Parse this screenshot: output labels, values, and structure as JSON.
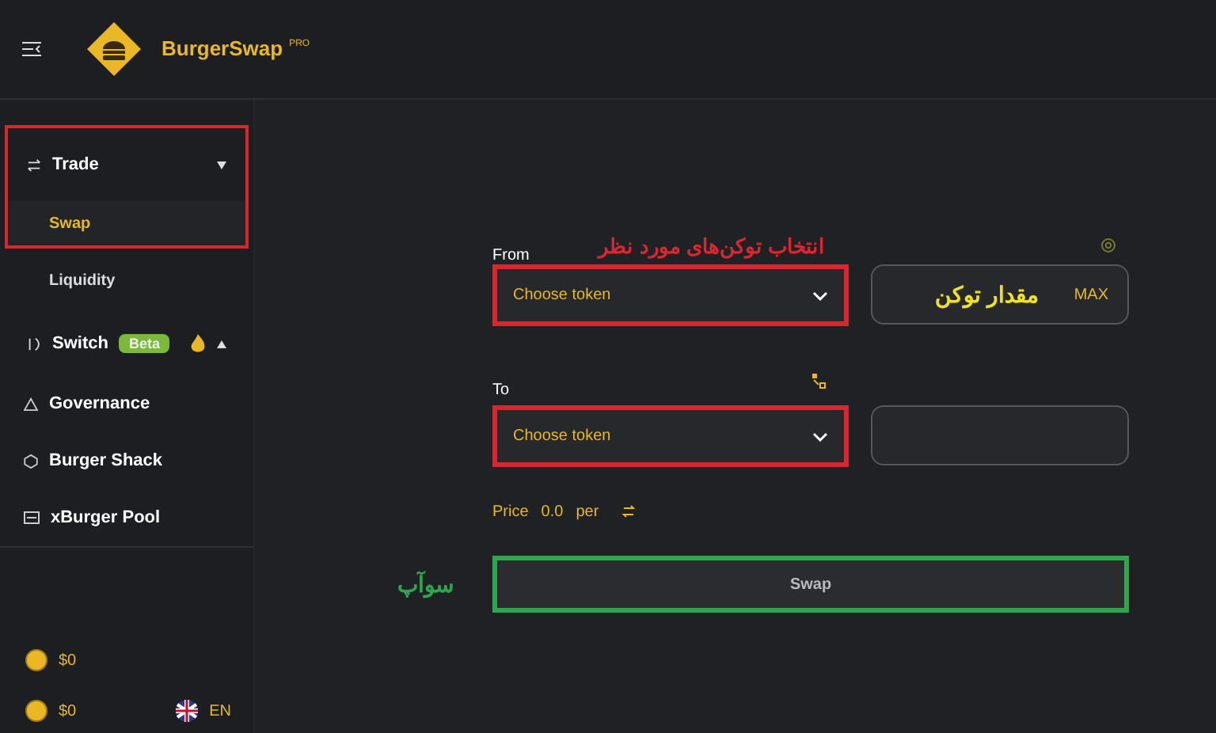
{
  "header": {
    "brand": "BurgerSwap",
    "badge": "PRO"
  },
  "sidebar": {
    "items": [
      {
        "kind": "group",
        "label": "Trade",
        "expanded": true,
        "outlined": true,
        "children": [
          {
            "label": "Swap",
            "selected": true
          },
          {
            "label": "Liquidity",
            "selected": false
          }
        ]
      },
      {
        "kind": "group",
        "label": "Switch",
        "tag": "Beta",
        "hot": true,
        "expanded": false
      },
      {
        "kind": "link",
        "label": "Governance"
      },
      {
        "kind": "link",
        "label": "Burger Shack"
      },
      {
        "kind": "link",
        "label": "xBurger Pool"
      }
    ],
    "footer": {
      "balances": [
        "$0",
        "$0"
      ],
      "language": "EN"
    }
  },
  "swap": {
    "from": {
      "label": "From",
      "note": "انتخاب توکن‌های مورد نظر",
      "select": {
        "value": "Choose token",
        "outlined": true
      },
      "amount": {
        "note": "مقدار توکن",
        "max": "MAX"
      }
    },
    "to": {
      "label": "To",
      "select": {
        "value": "Choose token",
        "outlined": true
      }
    },
    "price": {
      "label": "Price",
      "value": "0.0",
      "unit": "per"
    },
    "button": {
      "label": "Swap",
      "note": "سوآپ",
      "outlined": true
    }
  }
}
